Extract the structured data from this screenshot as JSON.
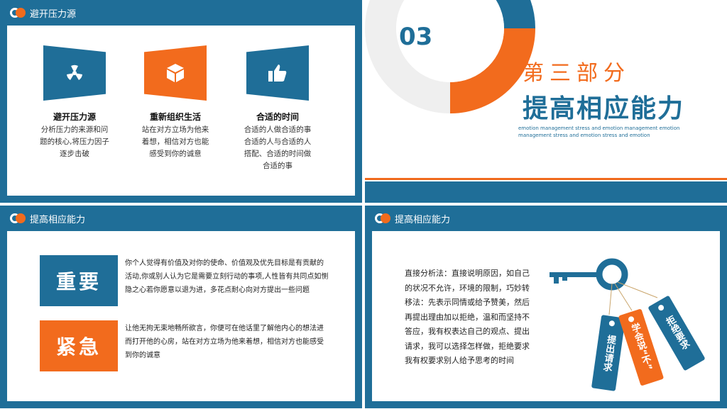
{
  "slide1": {
    "header": "避开压力源",
    "cards": [
      {
        "icon": "radiation-icon",
        "title": "避开压力源",
        "text": "分析压力的来源和问题的核心,将压力因子逐步击破"
      },
      {
        "icon": "cube-icon",
        "title": "重新组织生活",
        "text": "站在对方立场为他来着想，相信对方也能感受到你的诚意"
      },
      {
        "icon": "thumbs-up-icon",
        "title": "合适的时间",
        "text": "合适的人做合适的事合适的人与合适的人搭配、合适的时间做合适的事"
      }
    ]
  },
  "slide2": {
    "number": "03",
    "part": "第三部分",
    "title": "提高相应能力",
    "english": "emotion management stress and emotion management emotion management stress and emotion stress and emotion"
  },
  "slide3": {
    "header": "提高相应能力",
    "tag1": "重要",
    "tag2": "紧急",
    "para1": "你个人觉得有价值及对你的使命、价值观及优先目标是有贡献的活动,你或别人认为它是需要立刻行动的事项,人性皆有共同点如恻隐之心若你愿意以退为进，多花点耐心向对方提出一些问题",
    "para2": "让他无拘无束地畅所欲言，你便可在他话里了解他内心的想法进而打开他的心房，站在对方立场为他来着想，相信对方也能感受到你的诚意"
  },
  "slide4": {
    "header": "提高相应能力",
    "text": "直接分析法：直接说明原因，如自己的状况不允许，环境的限制，巧妙转移法：先表示同情或给予赞美，然后再提出理由加以拒绝，温和而坚持不答应，我有权表达自己的观点、提出请求，我可以选择怎样做，拒绝要求我有权要求别人给予思考的时间",
    "tags": [
      "提出请求",
      "学会说“不”",
      "拒绝要求"
    ]
  },
  "colors": {
    "blue": "#1f6e98",
    "orange": "#f26b1d"
  }
}
